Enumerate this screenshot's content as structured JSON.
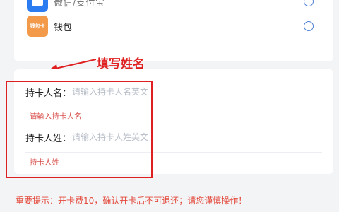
{
  "payment_options": [
    {
      "label": "微信/支付宝",
      "icon": "blue-app-icon",
      "selected": false
    },
    {
      "label": "钱包",
      "icon_text": "钱包卡",
      "icon": "wallet-icon",
      "selected": false
    }
  ],
  "form": {
    "first_name": {
      "label": "持卡人名：",
      "placeholder": "请输入持卡人名英文",
      "value": "",
      "error": "请输入持卡人名"
    },
    "last_name": {
      "label": "持卡人姓：",
      "placeholder": "请输入持卡人姓英文",
      "value": "",
      "error": "持卡人姓"
    }
  },
  "annotation": {
    "text": "填写姓名",
    "color": "#e02020"
  },
  "tip": "重要提示：开卡费10，确认开卡后不可退还；请您谨慎操作！",
  "colors": {
    "accent": "#2b7cf0",
    "error": "#d9534f",
    "annotation": "#e02020",
    "tip": "#e44a3c"
  }
}
